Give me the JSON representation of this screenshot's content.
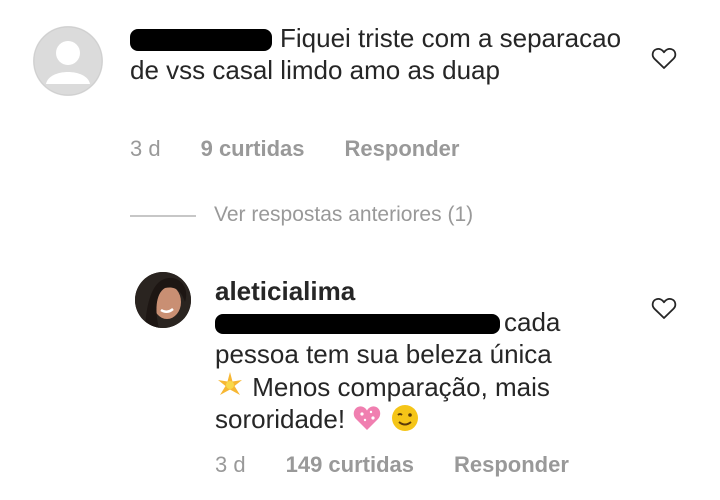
{
  "comments": [
    {
      "username_hidden": true,
      "text": "Fiquei triste com a separacao de vss casal limdo amo as duap",
      "time": "3 d",
      "likes": "9 curtidas",
      "reply": "Responder"
    },
    {
      "username": "aleticialima",
      "mention_hidden": true,
      "text_line1": "cada",
      "text_line2": "pessoa tem sua beleza única",
      "text_line3": "Menos comparação, mais",
      "text_line4": "sororidade!",
      "time": "3 d",
      "likes": "149 curtidas",
      "reply": "Responder"
    }
  ],
  "view_previous": "Ver respostas anteriores (1)",
  "icons": {
    "like": "heart-outline-icon",
    "sparkle": "sparkles-emoji",
    "heart_emoji": "sparkling-heart-emoji",
    "wink": "winking-face-emoji"
  }
}
